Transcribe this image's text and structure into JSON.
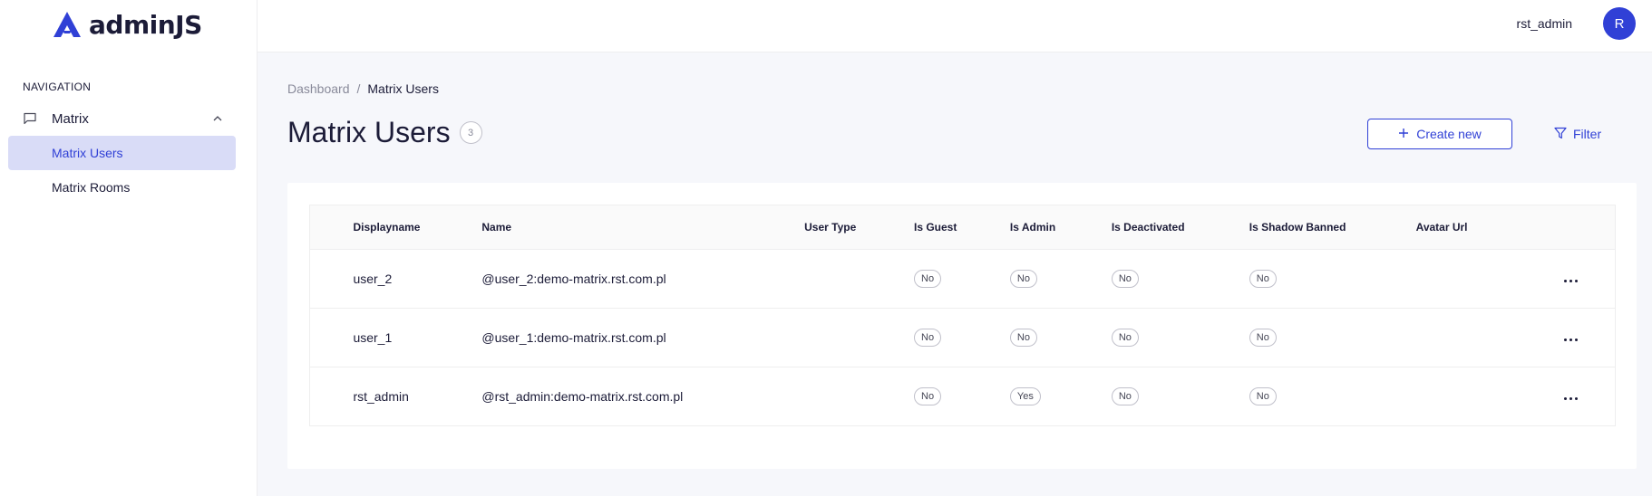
{
  "brand": {
    "name": "adminJS",
    "color": "#3040d6"
  },
  "sidebar": {
    "heading": "NAVIGATION",
    "group": {
      "label": "Matrix",
      "icon": "message-icon",
      "expanded": true
    },
    "items": [
      {
        "label": "Matrix Users",
        "active": true
      },
      {
        "label": "Matrix Rooms",
        "active": false
      }
    ]
  },
  "topbar": {
    "username": "rst_admin",
    "avatar_initial": "R"
  },
  "breadcrumb": {
    "root": "Dashboard",
    "separator": "/",
    "current": "Matrix Users"
  },
  "page": {
    "title": "Matrix Users",
    "count": "3"
  },
  "actions": {
    "create_label": "Create new",
    "filter_label": "Filter"
  },
  "table": {
    "headers": [
      "Displayname",
      "Name",
      "User Type",
      "Is Guest",
      "Is Admin",
      "Is Deactivated",
      "Is Shadow Banned",
      "Avatar Url"
    ],
    "rows": [
      {
        "displayname": "user_2",
        "name": "@user_2:demo-matrix.rst.com.pl",
        "user_type": "",
        "is_guest": "No",
        "is_admin": "No",
        "is_deactivated": "No",
        "is_shadow_banned": "No",
        "avatar_url": ""
      },
      {
        "displayname": "user_1",
        "name": "@user_1:demo-matrix.rst.com.pl",
        "user_type": "",
        "is_guest": "No",
        "is_admin": "No",
        "is_deactivated": "No",
        "is_shadow_banned": "No",
        "avatar_url": ""
      },
      {
        "displayname": "rst_admin",
        "name": "@rst_admin:demo-matrix.rst.com.pl",
        "user_type": "",
        "is_guest": "No",
        "is_admin": "Yes",
        "is_deactivated": "No",
        "is_shadow_banned": "No",
        "avatar_url": ""
      }
    ]
  }
}
